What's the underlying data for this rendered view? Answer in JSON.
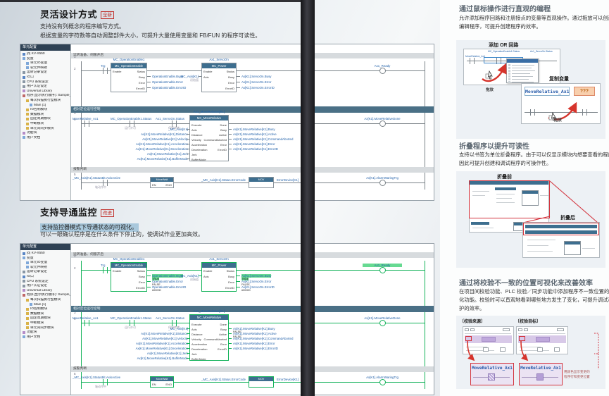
{
  "colors": {
    "accent_red": "#c2332e",
    "kv_blue": "#1f5fa8",
    "monitor_green": "#12b259",
    "teal_bar": "#4a7086",
    "highlight_blue": "#a9c8dc"
  },
  "left": {
    "s1": {
      "title": "灵活设计方式",
      "badge": "全新",
      "body": [
        "支持没有列概念的程序编写方式。",
        "根据变量的字符数等自动调整部件大小，可提升大量使用变量和 FB/FUN 的程序可读性。"
      ]
    },
    "s2": {
      "title": "支持导通监控",
      "badge": "改进",
      "body_hl": "支持监控器模式下导通状态的可视化。",
      "body": "可以一眼确认程序是在什么条件下停止的，使调试作业更加高效。"
    }
  },
  "tree": {
    "tab": "单元配置",
    "items": [
      {
        "label": "[0] KV-X550",
        "icon": "chip",
        "ind": 0
      },
      {
        "label": "变量",
        "icon": "doc",
        "ind": 0
      },
      {
        "label": "单元IO变量",
        "icon": "doc",
        "ind": 1
      },
      {
        "label": "软元件映射",
        "icon": "doc",
        "ind": 1
      },
      {
        "label": "运转记录设定",
        "icon": "gear",
        "ind": 0
      },
      {
        "label": "IO口",
        "icon": "chip",
        "ind": 0
      },
      {
        "label": "CPU 系统设定",
        "icon": "gear",
        "ind": 0
      },
      {
        "label": "用户认证设定",
        "icon": "gear",
        "ind": 0
      },
      {
        "label": "Universal Library",
        "icon": "lib",
        "ind": 0
      },
      {
        "label": "程序(显示执行顺序): Sample_Universal",
        "icon": "prog",
        "ind": 0
      },
      {
        "label": "每次扫描执行型模块",
        "icon": "folder",
        "ind": 1
      },
      {
        "label": "Main [1]",
        "icon": "doc",
        "ind": 2
      },
      {
        "label": "IO控制模块",
        "icon": "folder",
        "ind": 1
      },
      {
        "label": "数据模块",
        "icon": "folder",
        "ind": 1
      },
      {
        "label": "固定周期模块",
        "icon": "folder",
        "ind": 1
      },
      {
        "label": "中断模块",
        "icon": "folder",
        "ind": 1
      },
      {
        "label": "单元间同步模块",
        "icon": "folder",
        "ind": 1
      },
      {
        "label": "功能块",
        "icon": "lib",
        "ind": 0
      },
      {
        "label": "用户文档",
        "icon": "doc",
        "ind": 0
      }
    ]
  },
  "ladder": {
    "comment1": "运转准备、伺服开启",
    "comment2": "报警判断",
    "teal1": "相对定位运行控制",
    "numbers": [
      "1",
      "2",
      "3",
      "4",
      "5"
    ],
    "trg": "Trg",
    "coil1": "Ax1_Ready",
    "coil2": "Ax[K1].MoveRelativeDone",
    "coil3": "Ax[K1].AlarmWaringTrg",
    "fb1": {
      "var": "MC_OperationEnable1",
      "title": "MC_OperationEnable",
      "pin_l": "Enable",
      "pins_r": [
        "Status",
        "Busy",
        "Error",
        "ErrorID"
      ],
      "outs": [
        "OperationEnable.Busy",
        "OperationEnable.Error",
        "OperationEnable.ErrorID"
      ]
    },
    "fb2": {
      "var": "Ax1_ServoOn",
      "title": "MC_Power",
      "pins_l": [
        "Enable",
        "Axis"
      ],
      "pins_r": [
        "Status",
        "Busy",
        "Error",
        "ErrorID"
      ],
      "axis_in": "_MC_Axis[K1]",
      "axis_sub": "初始值",
      "outs": [
        "Ax[K1].ServoOn.Busy",
        "Ax[K1].ServoOn.Error",
        "Ax[K1].ServoOn.ErrorID"
      ]
    },
    "contacts2": [
      {
        "label": "MoveRelative_Ax1",
        "sub": ""
      },
      {
        "label": "MC_OperationEnable1.Status",
        "sub": "运行许可"
      },
      {
        "label": "Ax1_ServoOn.Status",
        "sub": "伺服就绪"
      }
    ],
    "fb3": {
      "var": "Ax1_MoveRelative[K1]",
      "title": "MC_MoveRelative",
      "rows": [
        {
          "l": "Execute",
          "r": "Done",
          "in": "",
          "out": ""
        },
        {
          "l": "Axis",
          "r": "Busy",
          "in": "_MC_Axis[K1]",
          "out": "Ax[K1].MoveRelative[K1].Busy"
        },
        {
          "l": "Distance",
          "r": "Active",
          "in": "Ax[K1].MoveRelative[K1].Distance",
          "out": "Ax[K1].MoveRelative[K1].Active"
        },
        {
          "l": "Velocity",
          "r": "CommandAborted",
          "in": "Ax[K1].MoveRelative[K1].Velocity",
          "out": "Ax[K1].MoveRelative[K1].CommandAborted"
        },
        {
          "l": "Acceleration",
          "r": "Error",
          "in": "Ax[K1].MoveRelative[K1].Acceleration",
          "out": "Ax[K1].MoveRelative[K1].Error"
        },
        {
          "l": "Deceleration",
          "r": "ErrorID",
          "in": "Ax[K1].MoveRelative[K1].Deceleration",
          "out": "Ax[K1].MoveRelative[K1].ErrorID"
        },
        {
          "l": "Jerk",
          "r": "",
          "in": "Ax[K1].MoveRelative[K1].Jerk",
          "out": ""
        },
        {
          "l": "BufferMode",
          "r": "",
          "in": "Ax[K1].MoveRelative[K1].BufferMode",
          "out": ""
        }
      ]
    },
    "contact3": {
      "label": "_MC_Axis[K1].StatusBit.AxisActive",
      "sub": "轴动作中"
    },
    "fb4": {
      "title": "MoveWait",
      "pin_l": "EN",
      "pin_r": "ENO"
    },
    "fb5": {
      "title": "MOV",
      "in": "_MC_Axis[K1].Status.ErrorCode",
      "out": "ErrorDevice[K1]"
    },
    "monitor": {
      "on": "TRUE",
      "off": "FALSE",
      "id": "#00000"
    }
  },
  "right": {
    "s1": {
      "title": "通过鼠标操作进行直观的编程",
      "body": [
        "允许添加程序回路和注册接点的变量等直观操作。通过拖放可以创建和",
        "编辑程序，可提升创建程序的效率。"
      ],
      "fig": {
        "label1": "添加 OR 回路",
        "label2": "复制变量",
        "drag": "拖放",
        "var_name": "MoveRelative_Ax1",
        "placeholder": "???",
        "top_label1": "MC_OperationEnable1.Status",
        "top_label2": "Ax1_ServoOn.Status",
        "contact_label": "MoveRelative_Ax1"
      }
    },
    "s2": {
      "title": "折叠程序以提升可读性",
      "body": [
        "支持以书签为单位折叠程序。由于可以仅显示模块内想要查看的程序，",
        "因此可提升创建和调试程序的可操作性。"
      ],
      "fig": {
        "before": "折叠前",
        "after": "折叠后"
      }
    },
    "s3": {
      "title": "通过将校验不一致的位置可视化来改善效率",
      "body": [
        "在项目间校验功能、PLC 校验／同步功能中添加程序不一致位置的可视",
        "化功能。校验时可以直观地看到哪些地方发生了变化，可提升调试和维",
        "护的效率。"
      ],
      "fig": {
        "src": "〔校验来源〕",
        "dst": "〔校验目标〕",
        "var_name": "MoveRelative_Ax1",
        "note": [
          "用颜色显示变更的",
          "程序行和变更位置"
        ]
      }
    }
  }
}
